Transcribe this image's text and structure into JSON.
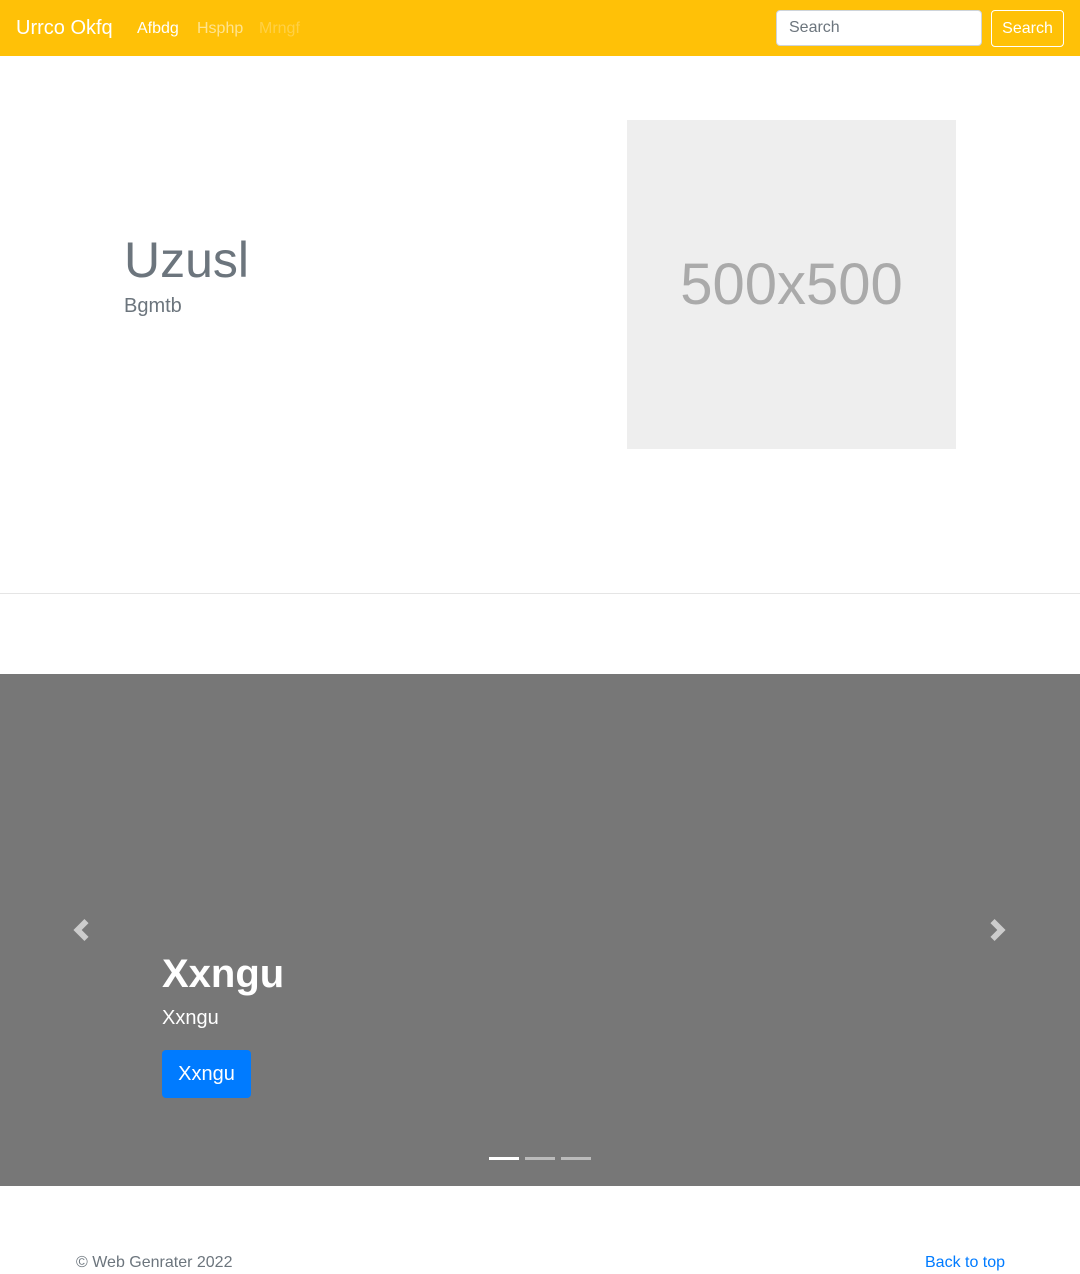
{
  "navbar": {
    "brand": "Urrco Okfq",
    "links": [
      {
        "label": "Afbdg"
      },
      {
        "label": "Hsphp"
      },
      {
        "label": "Mrngf"
      }
    ],
    "search_placeholder": "Search",
    "search_button": "Search",
    "background": "#ffc107"
  },
  "hero": {
    "title": "Uzusl",
    "subtitle": "Bgmtb",
    "image_label": "500x500"
  },
  "carousel": {
    "background": "#777777",
    "caption_title": "Xxngu",
    "caption_text": "Xxngu",
    "caption_button": "Xxngu",
    "slide_count": 3,
    "active_slide": 1,
    "prev_icon": "chevron-left-icon",
    "next_icon": "chevron-right-icon"
  },
  "footer": {
    "copyright": "© Web Genrater 2022",
    "back_to_top": "Back to top"
  }
}
